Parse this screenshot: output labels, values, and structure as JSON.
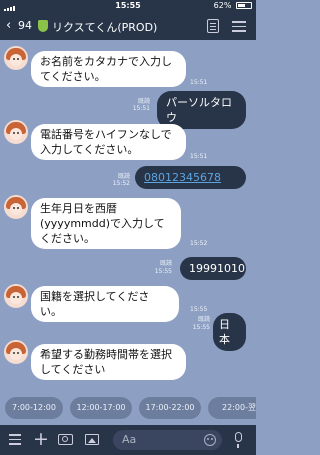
{
  "status": {
    "time": "15:55",
    "battery": "62%",
    "battery_level": 0.62
  },
  "header": {
    "back_count": "94",
    "title": "リクスてくん(PROD)"
  },
  "messages": [
    {
      "from": "bot",
      "text": "お名前をカタカナで入力してください。",
      "time": "15:51"
    },
    {
      "from": "user",
      "text": "パーソルタロウ",
      "read": "既読",
      "time": "15:51"
    },
    {
      "from": "bot",
      "text": "電話番号をハイフンなしで入力してください。",
      "time": "15:51"
    },
    {
      "from": "user",
      "text": "08012345678",
      "read": "既読",
      "time": "15:52"
    },
    {
      "from": "bot",
      "text": "生年月日を西暦(yyyymmdd)で入力してください。",
      "time": "15:52"
    },
    {
      "from": "user",
      "text": "19991010",
      "read": "既読",
      "time": "15:55"
    },
    {
      "from": "bot",
      "text": "国籍を選択してください。",
      "time": "15:55"
    },
    {
      "from": "user",
      "text": "日本",
      "read": "既読",
      "time": "15:55"
    },
    {
      "from": "bot",
      "text": "希望する勤務時間帯を選択してください"
    }
  ],
  "quick_replies": [
    "7:00-12:00",
    "12:00-17:00",
    "17:00-22:00",
    "22:00-翌"
  ],
  "composer": {
    "placeholder": "Aa"
  },
  "colors": {
    "background": "#8da0c4",
    "header": "#283448",
    "user_bubble": "#283448",
    "bot_bubble": "#ffffff",
    "link": "#5aa4e0"
  }
}
